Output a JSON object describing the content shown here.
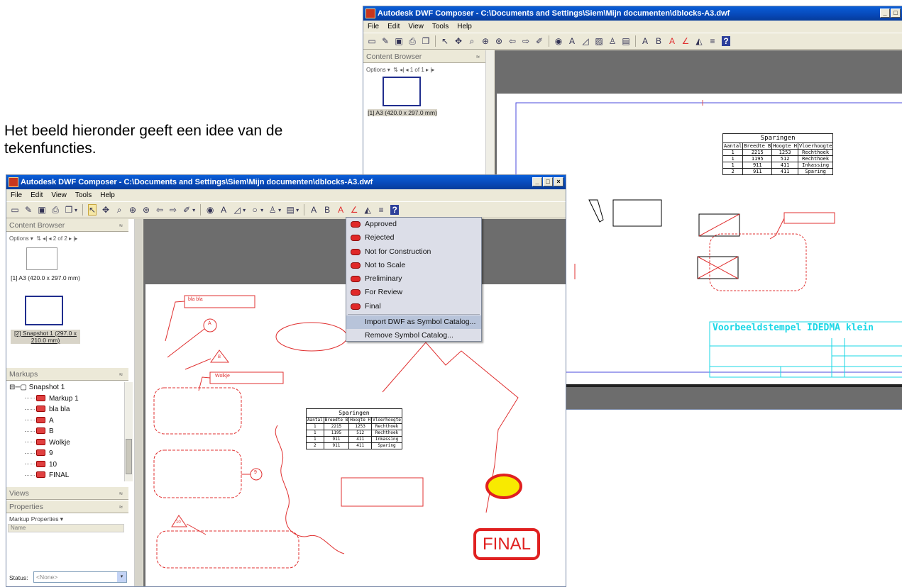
{
  "caption": "Het beeld hieronder geeft een idee van de tekenfuncties.",
  "colors": {
    "title_bar": "#0748b8",
    "markup_red": "#e03030",
    "window_bg": "#ece9d8",
    "view_dark": "#6d6d6d",
    "stamp_cyan": "#19d7e6",
    "border_blue": "#4a4adc",
    "ellipse_fill": "#f8ea00"
  },
  "back_window": {
    "title": "Autodesk DWF Composer - C:\\Documents and Settings\\Siem\\Mijn documenten\\dblocks-A3.dwf",
    "menu": [
      "File",
      "Edit",
      "View",
      "Tools",
      "Help"
    ],
    "content_browser": {
      "header": "Content Browser",
      "options": "Options ▾",
      "pager": "1 of 1",
      "thumbs": [
        {
          "label": "[1] A3 (420.0 x 297.0 mm)"
        }
      ]
    },
    "table": {
      "title": "Sparingen",
      "headers": [
        "Aantal",
        "Breedte B",
        "Hoogte H",
        "Vloerhoogte"
      ],
      "rows": [
        [
          "1",
          "2215",
          "1253",
          "Rechthoek"
        ],
        [
          "1",
          "1195",
          "512",
          "Rechthoek"
        ],
        [
          "1",
          "911",
          "411",
          "Inkassing"
        ],
        [
          "2",
          "911",
          "411",
          "Sparing"
        ]
      ]
    },
    "stamp": {
      "title": "Voorbeeldstempel IDEDMA klein"
    }
  },
  "front_window": {
    "title": "Autodesk DWF Composer - C:\\Documents and Settings\\Siem\\Mijn documenten\\dblocks-A3.dwf",
    "menu": [
      "File",
      "Edit",
      "View",
      "Tools",
      "Help"
    ],
    "toolbar_icons": [
      "new-icon",
      "open-icon",
      "save-icon",
      "print-icon",
      "copy-icon",
      "select-icon",
      "pan-icon",
      "zoom-window-icon",
      "zoom-icon",
      "zoom-fit-icon",
      "back-icon",
      "forward-icon",
      "pen-icon",
      "hide-icon",
      "text-icon",
      "callout-icon",
      "shape-icon",
      "stamp-icon",
      "measure-icon",
      "font-icon",
      "bold-icon",
      "underline-icon",
      "color-icon",
      "fill-icon",
      "line-icon",
      "help-icon"
    ],
    "content_browser": {
      "header": "Content Browser",
      "options": "Options ▾",
      "pager": "2 of 2",
      "thumbs": [
        {
          "label": "[1] A3 (420.0 x 297.0 mm)"
        },
        {
          "label": "[2] Snapshot 1 (297.0 x 210.0 mm)"
        }
      ]
    },
    "markups": {
      "header": "Markups",
      "root": "Snapshot 1",
      "items": [
        "Markup 1",
        "bla bla",
        "A",
        "B",
        "Wolkje",
        "9",
        "10",
        "FINAL"
      ]
    },
    "views_header": "Views",
    "properties": {
      "header": "Properties",
      "sub": "Markup Properties ▾",
      "name_label": "Name",
      "status_label": "Status:",
      "status_value": "<None>"
    },
    "stamp_menu": {
      "items": [
        "Approved",
        "Rejected",
        "Not for Construction",
        "Not to Scale",
        "Preliminary",
        "For Review",
        "Final"
      ],
      "actions": [
        "Import DWF as Symbol Catalog...",
        "Remove Symbol Catalog..."
      ]
    },
    "canvas": {
      "callout_1": "bla bla",
      "callout_2": "Wolkje",
      "bubble_1": "A",
      "triangle_1": "B",
      "bubble_2": "9",
      "triangle_2": "10",
      "final_stamp": "FINAL",
      "table": {
        "title": "Sparingen",
        "headers": [
          "Aantal",
          "Breedte B",
          "Hoogte H",
          "Vloerhoogte"
        ],
        "rows": [
          [
            "1",
            "2215",
            "1253",
            "Rechthoek"
          ],
          [
            "1",
            "1195",
            "512",
            "Rechthoek"
          ],
          [
            "1",
            "911",
            "411",
            "Inkassing"
          ],
          [
            "2",
            "911",
            "411",
            "Sparing"
          ]
        ]
      }
    }
  }
}
